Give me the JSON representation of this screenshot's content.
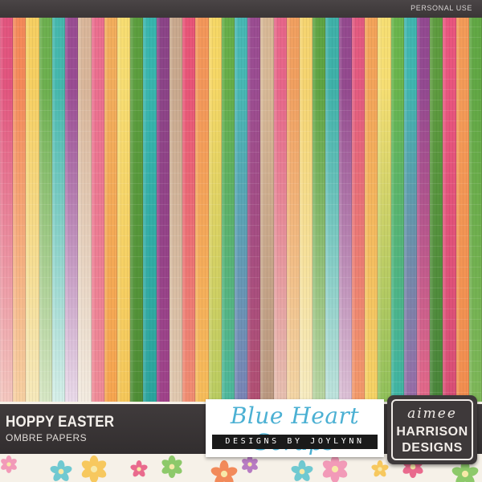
{
  "header": {
    "license_label": "PERSONAL USE"
  },
  "product": {
    "title": "HOPPY EASTER",
    "subtitle": "OMBRE PAPERS"
  },
  "brand_blue_heart": {
    "name": "Blue Heart Scraps",
    "tagline": "DESIGNS BY JOYLYNN",
    "name_color": "#4bb0d3"
  },
  "brand_aimee": {
    "first": "aimee",
    "last": "HARRISON",
    "designs": "DESIGNS",
    "accent": "#4cc0b8"
  },
  "papers": [
    {
      "top": "#e2557f",
      "bottom": "#f4c8c0"
    },
    {
      "top": "#f48a5a",
      "bottom": "#f7d1a3"
    },
    {
      "top": "#f6cf62",
      "bottom": "#f6e9bb"
    },
    {
      "top": "#6db04f",
      "bottom": "#d7e7c5"
    },
    {
      "top": "#45b8ad",
      "bottom": "#d6efe9"
    },
    {
      "top": "#9a4d93",
      "bottom": "#eadbea"
    },
    {
      "top": "#d9b69a",
      "bottom": "#f3ebe0"
    },
    {
      "top": "#eb6f8f",
      "bottom": "#ef8c98"
    },
    {
      "top": "#f2ad5c",
      "bottom": "#f6a650"
    },
    {
      "top": "#f7dd72",
      "bottom": "#f5c75a"
    },
    {
      "top": "#5c9e3e",
      "bottom": "#4f8e36"
    },
    {
      "top": "#38b5ae",
      "bottom": "#2ca49d"
    },
    {
      "top": "#8c4488",
      "bottom": "#a0438a"
    },
    {
      "top": "#c9a98e",
      "bottom": "#e1c9b0"
    },
    {
      "top": "#e85578",
      "bottom": "#f08e72"
    },
    {
      "top": "#f3975a",
      "bottom": "#f6bd5b"
    },
    {
      "top": "#f6d766",
      "bottom": "#b9cc62"
    },
    {
      "top": "#67ae49",
      "bottom": "#4db89e"
    },
    {
      "top": "#47b8b4",
      "bottom": "#7b84b6"
    },
    {
      "top": "#9b4d92",
      "bottom": "#b25073"
    },
    {
      "top": "#d7b896",
      "bottom": "#b9977f"
    },
    {
      "top": "#e7668a",
      "bottom": "#e7c1b1"
    },
    {
      "top": "#f1a060",
      "bottom": "#f3d6a6"
    },
    {
      "top": "#f5d470",
      "bottom": "#f6ebc0"
    },
    {
      "top": "#5fa443",
      "bottom": "#b9d5a3"
    },
    {
      "top": "#3fb1a9",
      "bottom": "#bfe3dd"
    },
    {
      "top": "#944a8f",
      "bottom": "#ddc2d7"
    },
    {
      "top": "#e35a80",
      "bottom": "#f39b6a"
    },
    {
      "top": "#f3a45a",
      "bottom": "#f5d466"
    },
    {
      "top": "#f6de73",
      "bottom": "#8fc05a"
    },
    {
      "top": "#6ab54d",
      "bottom": "#3fb5a7"
    },
    {
      "top": "#40b6b0",
      "bottom": "#9a6ba8"
    },
    {
      "top": "#934a91",
      "bottom": "#e56a8a"
    },
    {
      "top": "#5e9b3f",
      "bottom": "#49853a"
    },
    {
      "top": "#e8557e",
      "bottom": "#d84f76"
    },
    {
      "top": "#f39b58",
      "bottom": "#f28e50"
    },
    {
      "top": "#62a845",
      "bottom": "#7fb85a"
    }
  ],
  "flowers": [
    {
      "color": "#f29ab8",
      "petals": 6
    },
    {
      "color": "#6fc9d1",
      "petals": 5
    },
    {
      "color": "#f7c85e",
      "petals": 6
    },
    {
      "color": "#e96a8d",
      "petals": 5
    },
    {
      "color": "#8dc96a",
      "petals": 6
    },
    {
      "color": "#f28a5a",
      "petals": 5
    },
    {
      "color": "#b77bc2",
      "petals": 6
    },
    {
      "color": "#6fc9d1",
      "petals": 5
    },
    {
      "color": "#f29ab8",
      "petals": 6
    },
    {
      "color": "#f7c85e",
      "petals": 5
    },
    {
      "color": "#e96a8d",
      "petals": 6
    },
    {
      "color": "#8dc96a",
      "petals": 5
    }
  ]
}
